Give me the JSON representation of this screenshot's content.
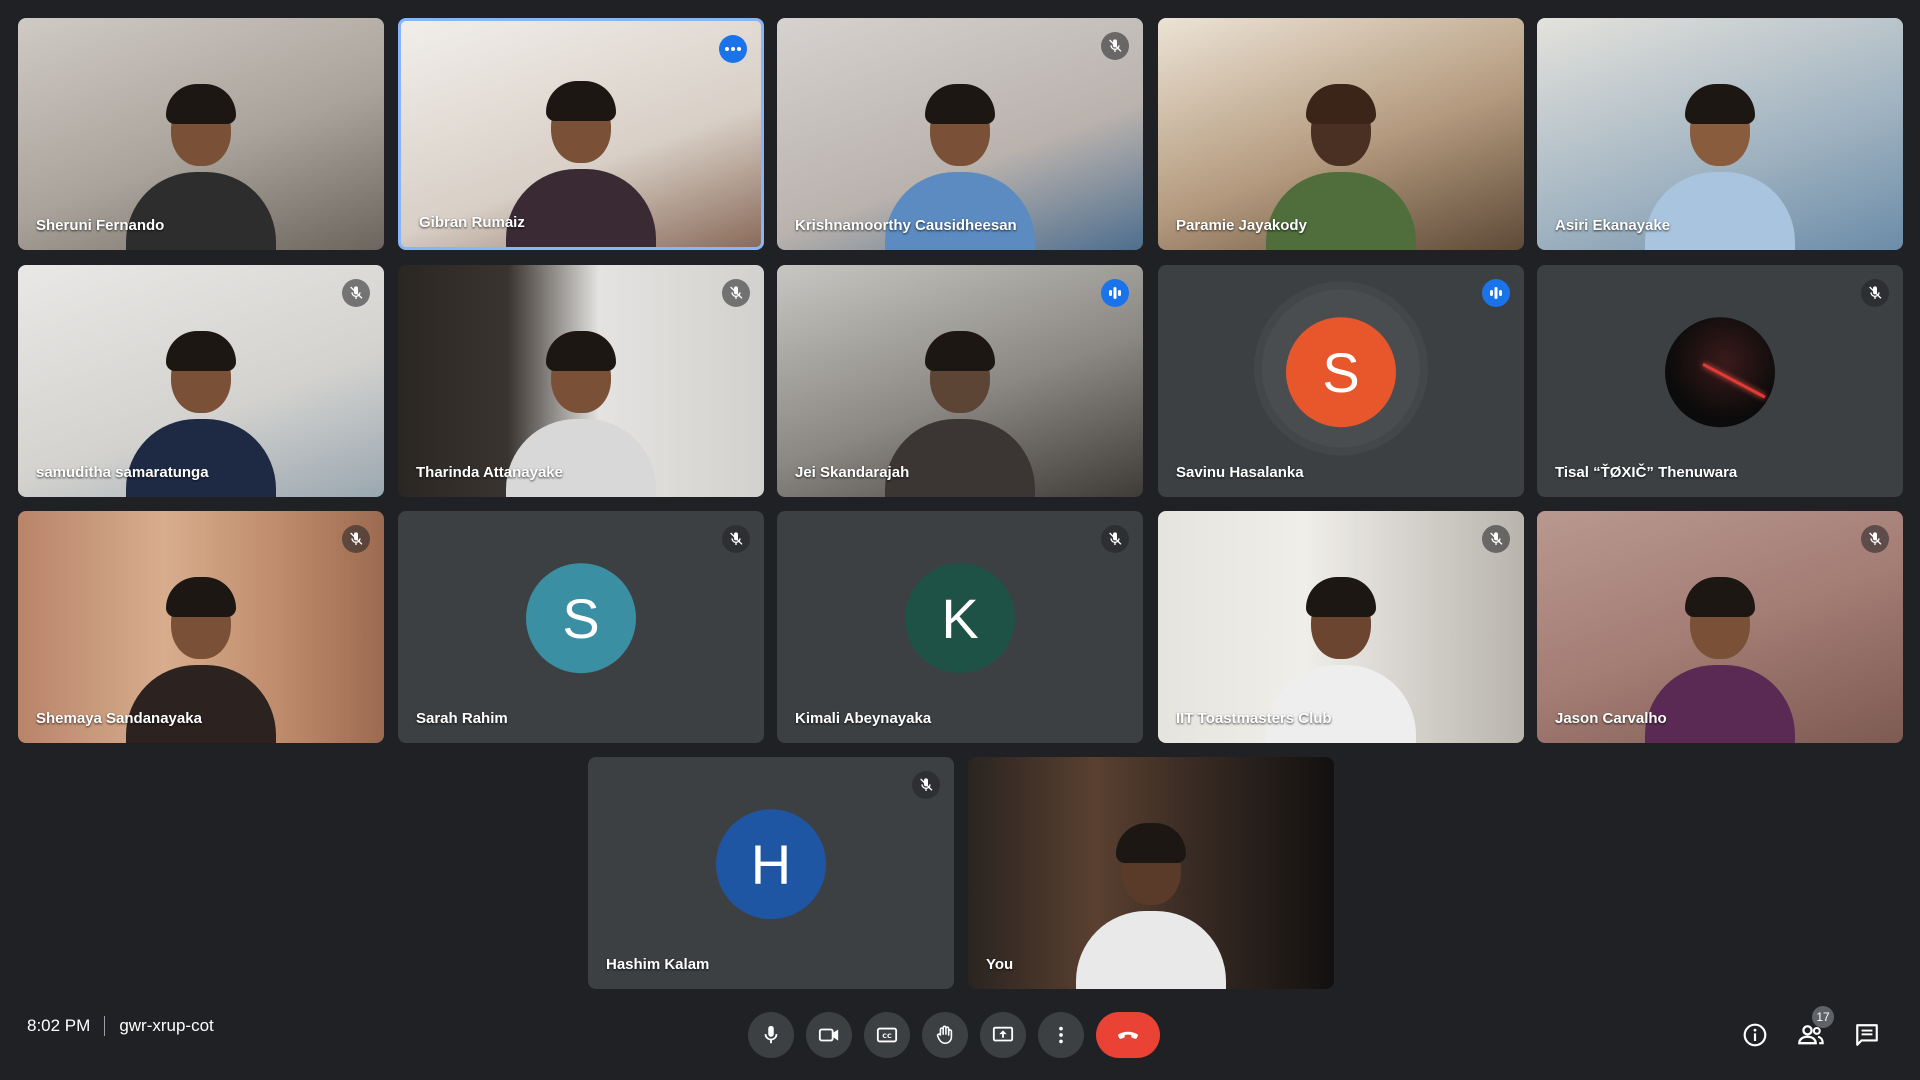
{
  "participants": [
    {
      "name": "Sheruni Fernando"
    },
    {
      "name": "Gibran Rumaiz"
    },
    {
      "name": "Krishnamoorthy Causidheesan"
    },
    {
      "name": "Paramie Jayakody"
    },
    {
      "name": "Asiri Ekanayake"
    },
    {
      "name": "samuditha samaratunga"
    },
    {
      "name": "Tharinda Attanayake"
    },
    {
      "name": "Jei Skandarajah"
    },
    {
      "name": "Savinu Hasalanka",
      "initial": "S",
      "color": "#e8572b"
    },
    {
      "name": "Tisal “ŤØXIČ” Thenuwara"
    },
    {
      "name": "Shemaya Sandanayaka"
    },
    {
      "name": "Sarah Rahim",
      "initial": "S",
      "color": "#3b8fa3"
    },
    {
      "name": "Kimali Abeynayaka",
      "initial": "K",
      "color": "#1f5246"
    },
    {
      "name": "IIT Toastmasters Club"
    },
    {
      "name": "Jason Carvalho"
    },
    {
      "name": "Hashim Kalam",
      "initial": "H",
      "color": "#1f56a3"
    },
    {
      "name": "You"
    }
  ],
  "meeting": {
    "time": "8:02 PM",
    "code": "gwr-xrup-cot"
  },
  "participant_count": "17",
  "colors": {
    "background": "#202124",
    "tile": "#3c4043",
    "accent": "#1a73e8",
    "end_call": "#ea4335"
  },
  "icons": {
    "controls": [
      "microphone-icon",
      "camera-icon",
      "captions-icon",
      "raise-hand-icon",
      "present-screen-icon",
      "more-options-icon",
      "end-call-icon"
    ],
    "right": [
      "info-icon",
      "people-icon",
      "chat-icon"
    ]
  }
}
